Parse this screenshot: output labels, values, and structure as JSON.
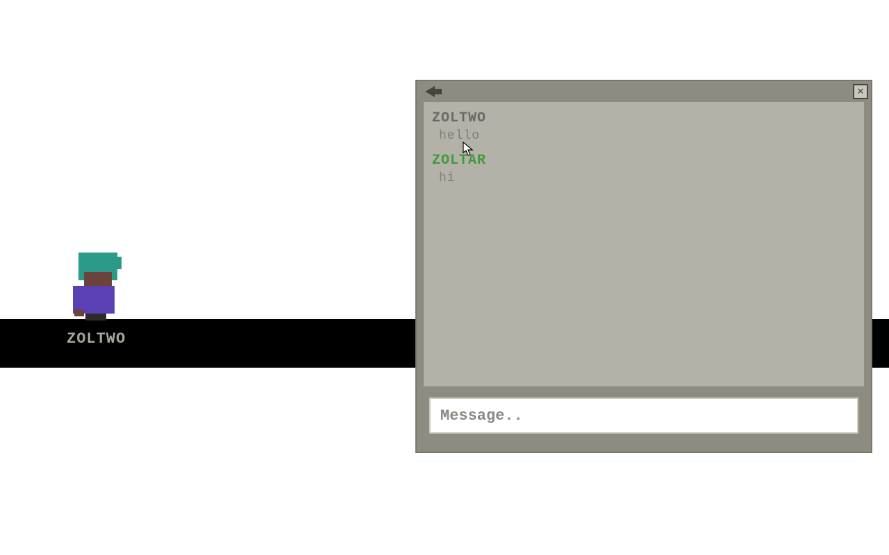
{
  "world": {
    "character_name": "ZOLTWO"
  },
  "chat": {
    "messages": [
      {
        "sender": "ZOLTWO",
        "text": "hello",
        "self": false
      },
      {
        "sender": "ZOLTAR",
        "text": "hi",
        "self": true
      }
    ],
    "input_placeholder": "Message.."
  },
  "icons": {
    "back": "back-arrow-icon",
    "close": "close-icon"
  }
}
